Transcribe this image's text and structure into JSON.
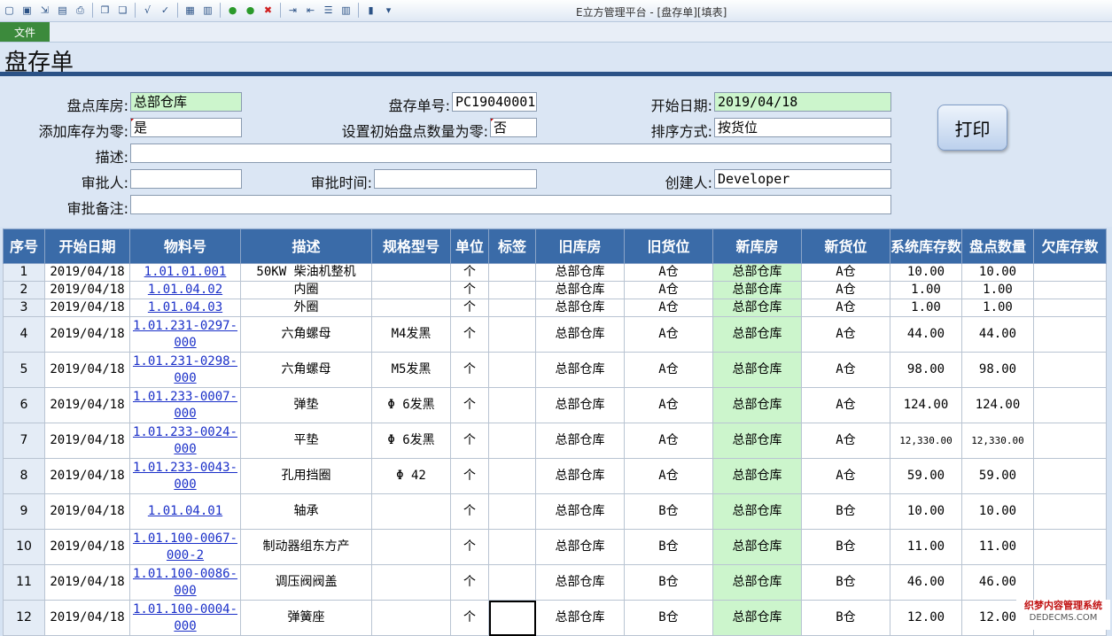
{
  "window_title": "E立方管理平台 - [盘存单][填表]",
  "toolbar_icons": [
    "new-icon",
    "save-icon",
    "export-icon",
    "preview-icon",
    "print-icon",
    "copy-window-icon",
    "paste-window-icon",
    "formula-icon",
    "formula-check-icon",
    "clipboard-icon",
    "report-icon",
    "go-forward-icon",
    "go-back-icon",
    "cancel-icon",
    "indent-icon",
    "outdent-icon",
    "list-icon",
    "columns-icon",
    "layout-icon",
    "dropdown-icon"
  ],
  "menu": {
    "file": "文件"
  },
  "page_title": "盘存单",
  "form": {
    "warehouse_label": "盘点库房:",
    "warehouse_value": "总部仓库",
    "doc_no_label": "盘存单号:",
    "doc_no_value": "PC19040001",
    "start_date_label": "开始日期:",
    "start_date_value": "2019/04/18",
    "add_zero_label": "添加库存为零:",
    "add_zero_value": "是",
    "init_zero_label": "设置初始盘点数量为零:",
    "init_zero_value": "否",
    "sort_label": "排序方式:",
    "sort_value": "按货位",
    "desc_label": "描述:",
    "desc_value": "",
    "approver_label": "审批人:",
    "approver_value": "",
    "approve_time_label": "审批时间:",
    "approve_time_value": "",
    "creator_label": "创建人:",
    "creator_value": "Developer",
    "approve_note_label": "审批备注:",
    "approve_note_value": "",
    "print_button": "打印"
  },
  "table": {
    "columns": [
      "序号",
      "开始日期",
      "物料号",
      "描述",
      "规格型号",
      "单位",
      "标签",
      "旧库房",
      "旧货位",
      "新库房",
      "新货位",
      "系统库存数",
      "盘点数量",
      "欠库存数"
    ],
    "rows": [
      {
        "no": "1",
        "date": "2019/04/18",
        "item": "1.01.01.001",
        "desc": "50KW 柴油机整机",
        "spec": "",
        "unit": "个",
        "tag": "",
        "old_wh": "总部仓库",
        "old_loc": "A仓",
        "new_wh": "总部仓库",
        "new_loc": "A仓",
        "sys_qty": "10.00",
        "count_qty": "10.00",
        "short_qty": ""
      },
      {
        "no": "2",
        "date": "2019/04/18",
        "item": "1.01.04.02",
        "desc": "内圈",
        "spec": "",
        "unit": "个",
        "tag": "",
        "old_wh": "总部仓库",
        "old_loc": "A仓",
        "new_wh": "总部仓库",
        "new_loc": "A仓",
        "sys_qty": "1.00",
        "count_qty": "1.00",
        "short_qty": ""
      },
      {
        "no": "3",
        "date": "2019/04/18",
        "item": "1.01.04.03",
        "desc": "外圈",
        "spec": "",
        "unit": "个",
        "tag": "",
        "old_wh": "总部仓库",
        "old_loc": "A仓",
        "new_wh": "总部仓库",
        "new_loc": "A仓",
        "sys_qty": "1.00",
        "count_qty": "1.00",
        "short_qty": ""
      },
      {
        "no": "4",
        "date": "2019/04/18",
        "item": "1.01.231-0297-000",
        "desc": "六角螺母",
        "spec": "M4发黑",
        "unit": "个",
        "tag": "",
        "old_wh": "总部仓库",
        "old_loc": "A仓",
        "new_wh": "总部仓库",
        "new_loc": "A仓",
        "sys_qty": "44.00",
        "count_qty": "44.00",
        "short_qty": ""
      },
      {
        "no": "5",
        "date": "2019/04/18",
        "item": "1.01.231-0298-000",
        "desc": "六角螺母",
        "spec": "M5发黑",
        "unit": "个",
        "tag": "",
        "old_wh": "总部仓库",
        "old_loc": "A仓",
        "new_wh": "总部仓库",
        "new_loc": "A仓",
        "sys_qty": "98.00",
        "count_qty": "98.00",
        "short_qty": ""
      },
      {
        "no": "6",
        "date": "2019/04/18",
        "item": "1.01.233-0007-000",
        "desc": "弹垫",
        "spec": "Φ 6发黑",
        "unit": "个",
        "tag": "",
        "old_wh": "总部仓库",
        "old_loc": "A仓",
        "new_wh": "总部仓库",
        "new_loc": "A仓",
        "sys_qty": "124.00",
        "count_qty": "124.00",
        "short_qty": ""
      },
      {
        "no": "7",
        "date": "2019/04/18",
        "item": "1.01.233-0024-000",
        "desc": "平垫",
        "spec": "Φ 6发黑",
        "unit": "个",
        "tag": "",
        "old_wh": "总部仓库",
        "old_loc": "A仓",
        "new_wh": "总部仓库",
        "new_loc": "A仓",
        "sys_qty": "12,330.00",
        "count_qty": "12,330.00",
        "short_qty": ""
      },
      {
        "no": "8",
        "date": "2019/04/18",
        "item": "1.01.233-0043-000",
        "desc": "孔用挡圈",
        "spec": "Φ 42",
        "unit": "个",
        "tag": "",
        "old_wh": "总部仓库",
        "old_loc": "A仓",
        "new_wh": "总部仓库",
        "new_loc": "A仓",
        "sys_qty": "59.00",
        "count_qty": "59.00",
        "short_qty": ""
      },
      {
        "no": "9",
        "date": "2019/04/18",
        "item": "1.01.04.01",
        "desc": "轴承",
        "spec": "",
        "unit": "个",
        "tag": "",
        "old_wh": "总部仓库",
        "old_loc": "B仓",
        "new_wh": "总部仓库",
        "new_loc": "B仓",
        "sys_qty": "10.00",
        "count_qty": "10.00",
        "short_qty": ""
      },
      {
        "no": "10",
        "date": "2019/04/18",
        "item": "1.01.100-0067-000-2",
        "desc": "制动器组东方产",
        "spec": "",
        "unit": "个",
        "tag": "",
        "old_wh": "总部仓库",
        "old_loc": "B仓",
        "new_wh": "总部仓库",
        "new_loc": "B仓",
        "sys_qty": "11.00",
        "count_qty": "11.00",
        "short_qty": ""
      },
      {
        "no": "11",
        "date": "2019/04/18",
        "item": "1.01.100-0086-000",
        "desc": "调压阀阀盖",
        "spec": "",
        "unit": "个",
        "tag": "",
        "old_wh": "总部仓库",
        "old_loc": "B仓",
        "new_wh": "总部仓库",
        "new_loc": "B仓",
        "sys_qty": "46.00",
        "count_qty": "46.00",
        "short_qty": ""
      },
      {
        "no": "12",
        "date": "2019/04/18",
        "item": "1.01.100-0004-000",
        "desc": "弹簧座",
        "spec": "",
        "unit": "个",
        "tag": "",
        "old_wh": "总部仓库",
        "old_loc": "B仓",
        "new_wh": "总部仓库",
        "new_loc": "B仓",
        "sys_qty": "12.00",
        "count_qty": "12.00",
        "short_qty": ""
      }
    ]
  },
  "watermark": {
    "line1": "织梦内容管理系统",
    "line2": "DEDECMS.COM"
  }
}
